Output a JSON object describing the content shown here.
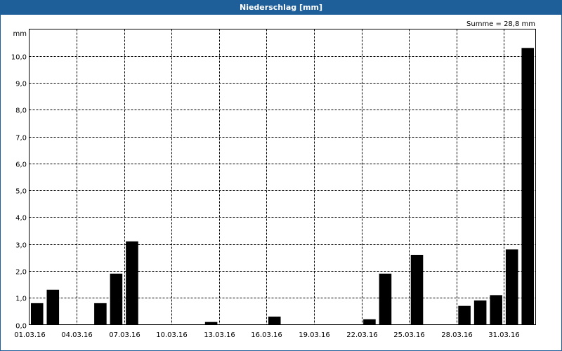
{
  "window": {
    "title": "Niederschlag [mm]"
  },
  "summary": {
    "text": "Summe = 28,8 mm"
  },
  "colors": {
    "titlebar": "#1f5f99",
    "bar": "#000000",
    "grid": "#000000"
  },
  "chart_data": {
    "type": "bar",
    "ylabel": "mm",
    "ylim": [
      0,
      11
    ],
    "grid": true,
    "y_ticks": [
      "0,0",
      "1,0",
      "2,0",
      "3,0",
      "4,0",
      "5,0",
      "6,0",
      "7,0",
      "8,0",
      "9,0",
      "10,0"
    ],
    "x_ticks": [
      "01.03.16",
      "04.03.16",
      "07.03.16",
      "10.03.16",
      "13.03.16",
      "16.03.16",
      "19.03.16",
      "22.03.16",
      "25.03.16",
      "28.03.16",
      "31.03.16"
    ],
    "categories": [
      "01.03.16",
      "02.03.16",
      "03.03.16",
      "04.03.16",
      "05.03.16",
      "06.03.16",
      "07.03.16",
      "08.03.16",
      "09.03.16",
      "10.03.16",
      "11.03.16",
      "12.03.16",
      "13.03.16",
      "14.03.16",
      "15.03.16",
      "16.03.16",
      "17.03.16",
      "18.03.16",
      "19.03.16",
      "20.03.16",
      "21.03.16",
      "22.03.16",
      "23.03.16",
      "24.03.16",
      "25.03.16",
      "26.03.16",
      "27.03.16",
      "28.03.16",
      "29.03.16",
      "30.03.16",
      "31.03.16"
    ],
    "values": [
      0.8,
      1.3,
      0,
      0,
      0.8,
      1.9,
      3.1,
      0,
      0,
      0,
      0,
      0.1,
      0,
      0,
      0,
      0.3,
      0,
      0,
      0,
      0,
      0,
      0.2,
      1.9,
      0,
      2.6,
      0,
      0,
      0.7,
      0.9,
      1.1,
      2.8,
      10.3
    ]
  }
}
